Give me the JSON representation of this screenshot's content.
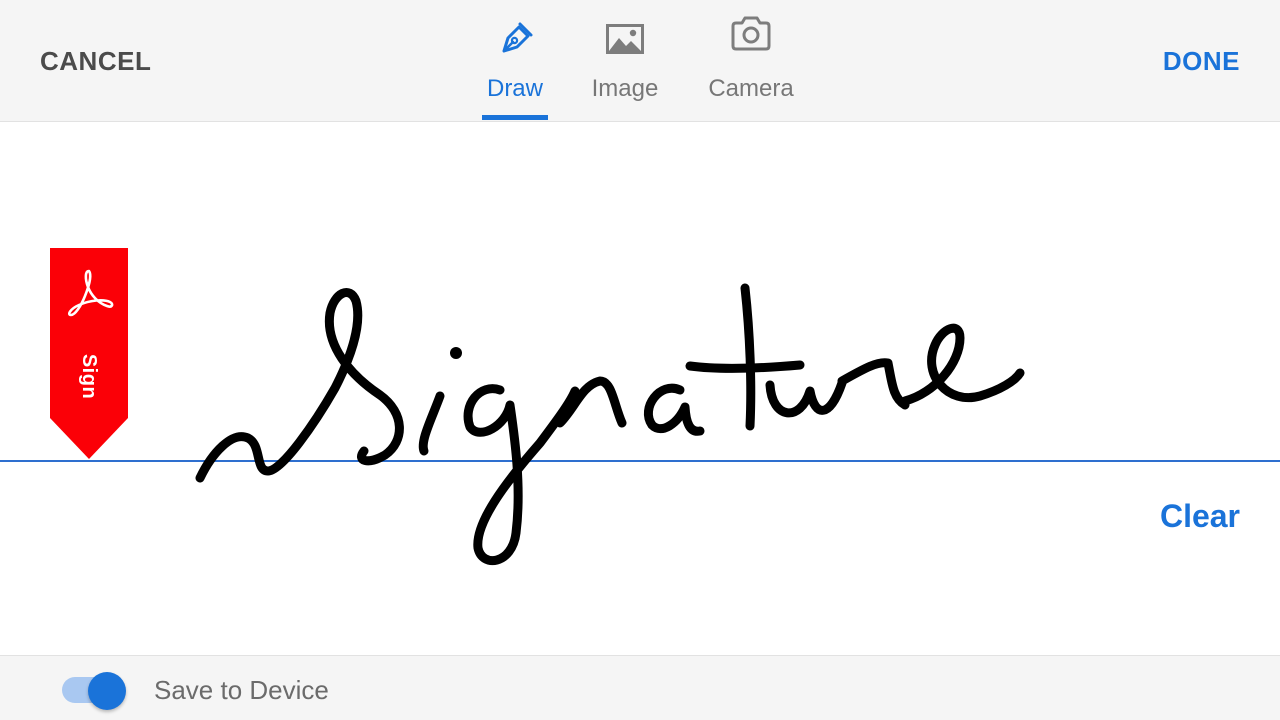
{
  "toolbar": {
    "cancel_label": "CANCEL",
    "done_label": "DONE"
  },
  "tabs": [
    {
      "label": "Draw",
      "icon": "pen-icon",
      "active": true
    },
    {
      "label": "Image",
      "icon": "image-icon",
      "active": false
    },
    {
      "label": "Camera",
      "icon": "camera-icon",
      "active": false
    }
  ],
  "canvas": {
    "badge_label": "Sign",
    "badge_icon": "acrobat-logo-icon",
    "clear_label": "Clear",
    "signature_icon": "handwritten-signature"
  },
  "footer": {
    "save_toggle_on": true,
    "save_label": "Save to Device"
  },
  "colors": {
    "accent": "#1a73d9",
    "badge_red": "#fb0007",
    "toolbar_bg": "#f5f5f5",
    "ink": "#000000"
  }
}
